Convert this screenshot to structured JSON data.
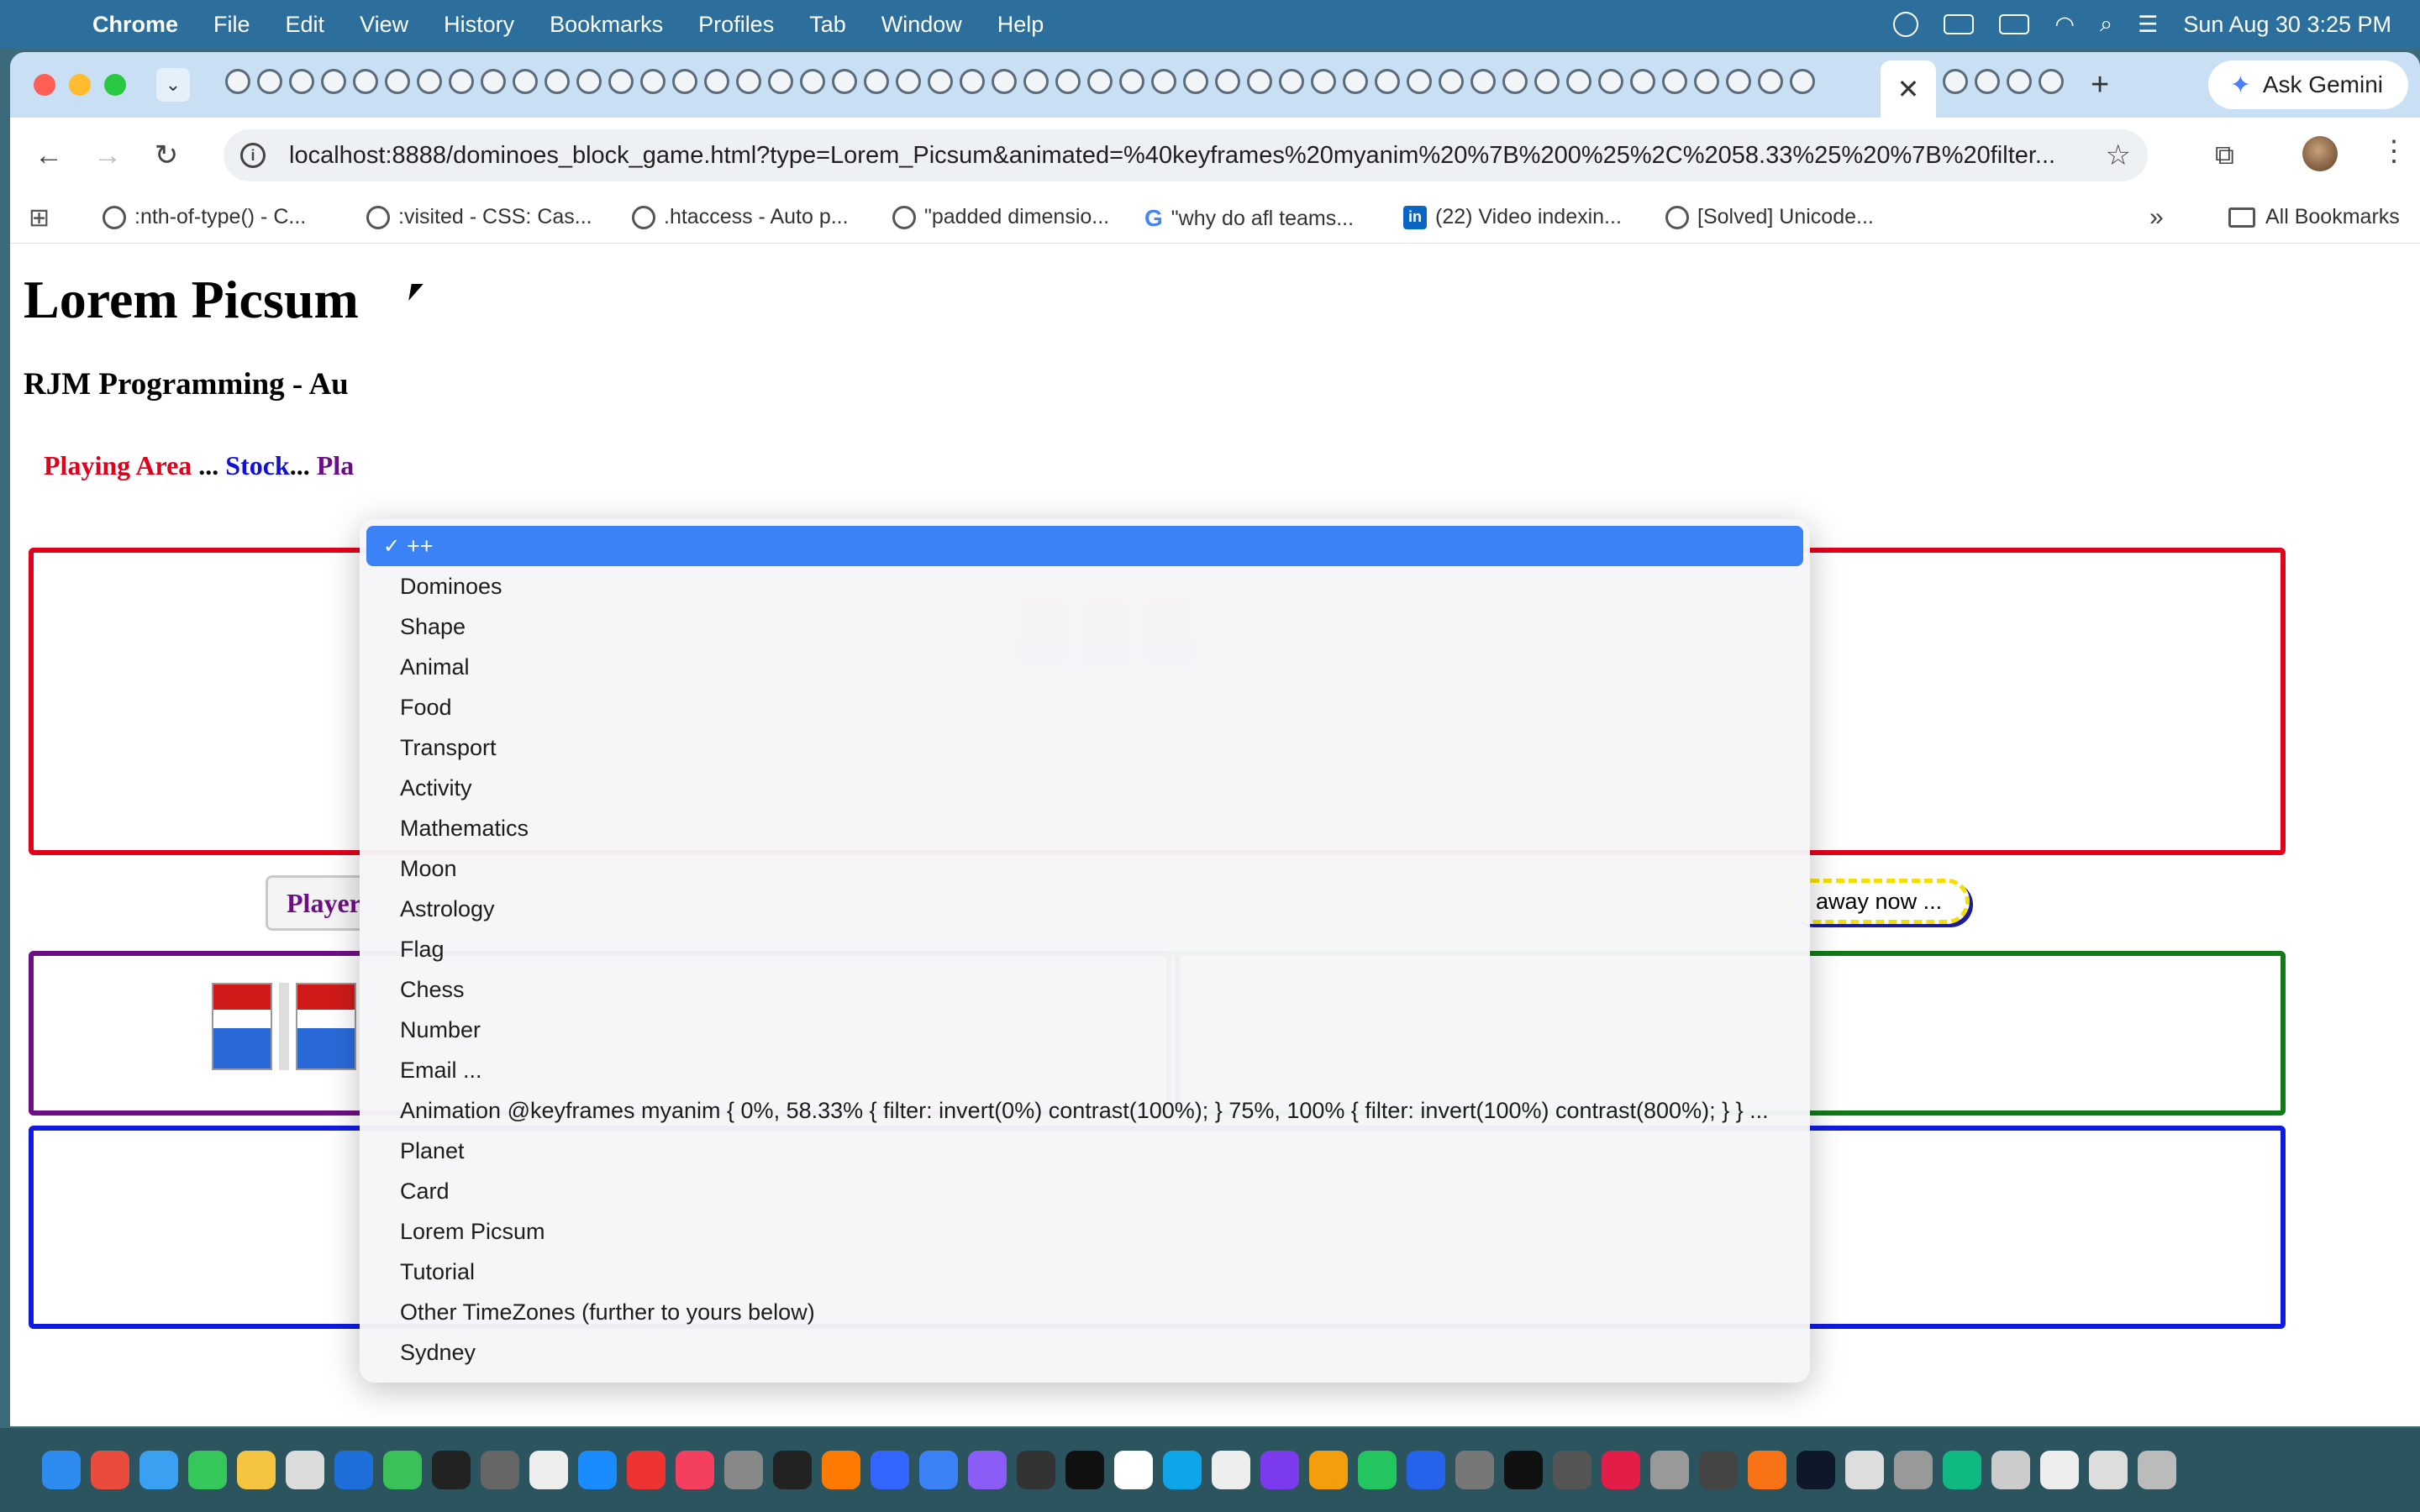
{
  "menubar": {
    "apple": "",
    "app_name": "Chrome",
    "menus": [
      "File",
      "Edit",
      "View",
      "History",
      "Bookmarks",
      "Profiles",
      "Tab",
      "Window",
      "Help"
    ],
    "clock": "Sun Aug 30  3:25 PM"
  },
  "browser": {
    "ask_gemini": "Ask Gemini",
    "url": "localhost:8888/dominoes_block_game.html?type=Lorem_Picsum&animated=%40keyframes%20myanim%20%7B%200%25%2C%2058.33%25%20%7B%20filter...",
    "bookmarks": [
      {
        "icon": "globe",
        "label": ":nth-of-type() - C..."
      },
      {
        "icon": "globe",
        "label": ":visited - CSS: Cas..."
      },
      {
        "icon": "globe",
        "label": ".htaccess - Auto p..."
      },
      {
        "icon": "globe",
        "label": "\"padded dimensio..."
      },
      {
        "icon": "google",
        "label": "\"why do afl teams..."
      },
      {
        "icon": "linkedin",
        "label": "(22) Video indexin..."
      },
      {
        "icon": "globe",
        "label": "[Solved] Unicode..."
      }
    ],
    "all_bookmarks": "All Bookmarks"
  },
  "page": {
    "title": "Lorem Picsum",
    "subtitle": "RJM Programming - Au",
    "legend": {
      "playing_area": "Playing Area",
      "sep1": " ... ",
      "stock": "Stock",
      "sep2": "... ",
      "player": "Pla"
    },
    "player_button": "Player",
    "hint": "away now ..."
  },
  "dropdown": {
    "selected": "++",
    "options": [
      "Dominoes",
      "Shape",
      "Animal",
      "Food",
      "Transport",
      "Activity",
      "Mathematics",
      "Moon",
      "Astrology",
      "Flag",
      "Chess",
      "Number",
      "Email ...",
      "Animation @keyframes myanim { 0%, 58.33% { filter: invert(0%) contrast(100%); } 75%, 100% { filter: invert(100%) contrast(800%); } } ...",
      "Planet",
      "Card",
      "Lorem Picsum",
      "Tutorial",
      "Other TimeZones (further to yours below)",
      "Sydney"
    ]
  },
  "colors": {
    "playing_area": "#e3001b",
    "stock": "#0f1be2",
    "player": "#6d0f84",
    "green_area": "#0f7a16",
    "selection": "#3b82f6"
  }
}
